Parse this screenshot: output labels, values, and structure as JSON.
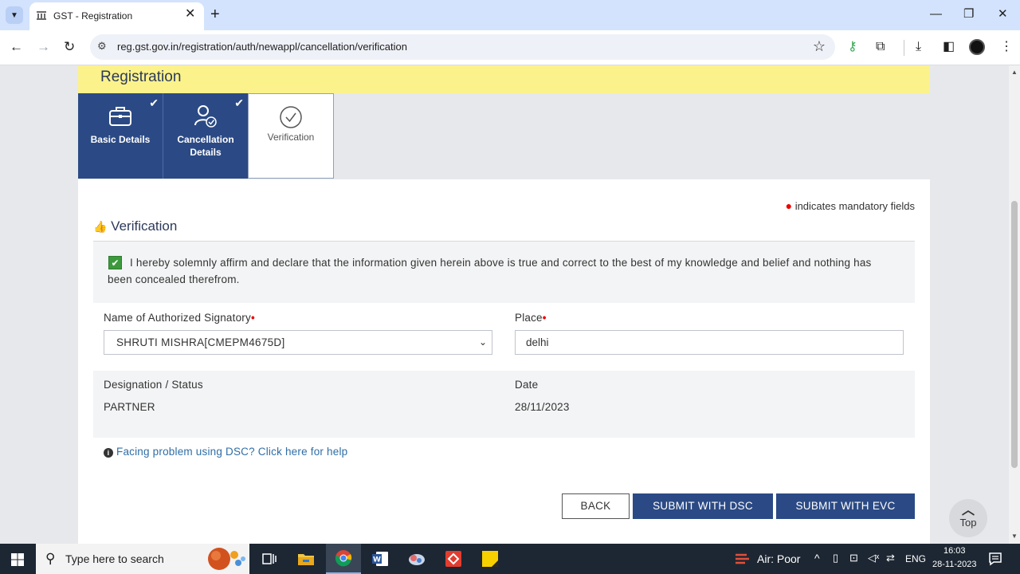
{
  "browser": {
    "tab_title": "GST - Registration",
    "url": "reg.gst.gov.in/registration/auth/newappl/cancellation/verification"
  },
  "page": {
    "banner_title": "Registration",
    "steps": [
      {
        "label": "Basic Details",
        "completed": true
      },
      {
        "label": "Cancellation\nDetails",
        "completed": true
      },
      {
        "label": "Verification",
        "completed": false
      }
    ],
    "mandatory_note": "indicates mandatory fields",
    "section_title": "Verification",
    "declaration_text": "I hereby solemnly affirm and declare that the information given herein above is true and correct to the best of my knowledge and belief and nothing has been concealed therefrom.",
    "declaration_checked": true,
    "signatory_label": "Name of Authorized Signatory",
    "signatory_value": "SHRUTI MISHRA[CMEPM4675D]",
    "place_label": "Place",
    "place_value": "delhi",
    "designation_label": "Designation / Status",
    "designation_value": "PARTNER",
    "date_label": "Date",
    "date_value": "28/11/2023",
    "help_link": "Facing problem using DSC? Click here for help",
    "buttons": {
      "back": "BACK",
      "submit_dsc": "SUBMIT WITH DSC",
      "submit_evc": "SUBMIT WITH EVC"
    },
    "top_label": "Top"
  },
  "taskbar": {
    "search_placeholder": "Type here to search",
    "air_quality": "Air: Poor",
    "language": "ENG",
    "time": "16:03",
    "date": "28-11-2023"
  },
  "colors": {
    "banner": "#fcf28c",
    "primary": "#2b4a85",
    "link": "#2f6ea6",
    "check": "#3c9a3c"
  }
}
